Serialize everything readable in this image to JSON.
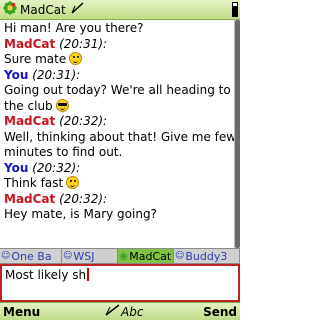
{
  "title": "MadCat",
  "colors": {
    "madcat": "#c8141e",
    "you": "#1414c8",
    "active_tab": "#7fc244",
    "input_border": "#b22222"
  },
  "messages": [
    {
      "type": "text",
      "text": "Hi man! Are you there?"
    },
    {
      "type": "sender",
      "who": "MadCat",
      "time": "(20:31):"
    },
    {
      "type": "text",
      "text": "Sure mate",
      "emoticon": "smile"
    },
    {
      "type": "sender",
      "who": "You",
      "time": "(20:31):"
    },
    {
      "type": "text",
      "text": "Going out today? We're all heading to",
      "wrap": false
    },
    {
      "type": "text",
      "text": "the club",
      "emoticon": "cool"
    },
    {
      "type": "sender",
      "who": "MadCat",
      "time": "(20:32):"
    },
    {
      "type": "text",
      "text": "Well, thinking about that! Give me few"
    },
    {
      "type": "text",
      "text": "minutes to find out."
    },
    {
      "type": "sender",
      "who": "You",
      "time": "(20:32):"
    },
    {
      "type": "text",
      "text": "Think fast",
      "emoticon": "smile"
    },
    {
      "type": "sender",
      "who": "MadCat",
      "time": "(20:32):"
    },
    {
      "type": "text",
      "text": "Hey mate, is Mary going?"
    }
  ],
  "tabs": [
    {
      "label": "One Ba",
      "icon": "person-icon",
      "active": false
    },
    {
      "label": "WSJ",
      "icon": "person-icon",
      "active": false
    },
    {
      "label": "MadCat",
      "icon": "icq-flower-icon",
      "active": true
    },
    {
      "label": "Buddy3",
      "icon": "person-icon",
      "active": false
    }
  ],
  "input": {
    "value": "Most likely sh"
  },
  "softkeys": {
    "left": "Menu",
    "mode": "Abc",
    "right": "Send"
  },
  "scroll": {
    "position": 0.0,
    "visible_fraction": 1.0
  }
}
